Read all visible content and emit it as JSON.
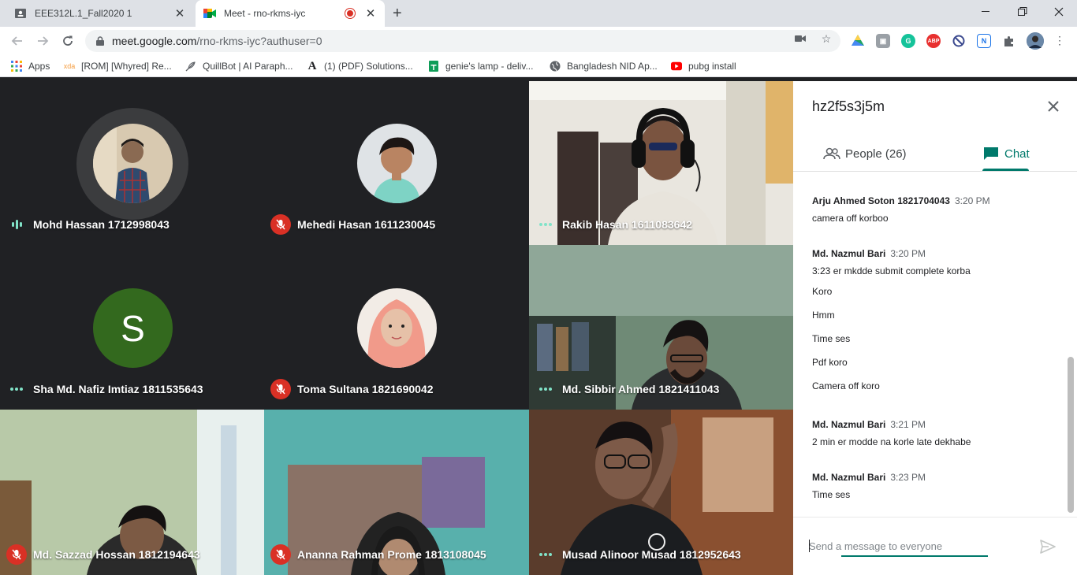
{
  "browser": {
    "tabs": [
      {
        "title": "EEE312L.1_Fall2020 1",
        "favicon": "classroom-icon"
      },
      {
        "title": "Meet - rno-rkms-iyc",
        "favicon": "meet-icon",
        "recording": true
      }
    ],
    "url_host": "meet.google.com",
    "url_path": "/rno-rkms-iyc?authuser=0",
    "bookmarks": [
      {
        "label": "Apps",
        "icon": "apps-grid-icon"
      },
      {
        "label": "[ROM] [Whyred] Re...",
        "icon": "xda-icon"
      },
      {
        "label": "QuillBot | AI Paraph...",
        "icon": "feather-icon"
      },
      {
        "label": "(1) (PDF) Solutions...",
        "icon": "font-a-icon"
      },
      {
        "label": "genie's lamp - deliv...",
        "icon": "sheet-icon"
      },
      {
        "label": "Bangladesh NID Ap...",
        "icon": "globe-icon"
      },
      {
        "label": "pubg install",
        "icon": "youtube-icon"
      }
    ],
    "extensions": [
      "drive-ext-icon",
      "photo-ext-icon",
      "grammarly-icon",
      "adblock-icon",
      "block-icon",
      "onenote-icon",
      "puzzle-icon",
      "profile-avatar"
    ]
  },
  "meet": {
    "tiles": [
      {
        "name": "Mohd Hassan 1712998043",
        "status": "speaking",
        "type": "avatar"
      },
      {
        "name": "Mehedi Hasan 1611230045",
        "status": "muted",
        "type": "avatar"
      },
      {
        "name": "Rakib Hasan 1611083642",
        "status": "dots",
        "type": "video"
      },
      {
        "name": "Sha Md. Nafiz Imtiaz 1811535643",
        "status": "dots",
        "type": "letter",
        "letter": "S"
      },
      {
        "name": "Toma Sultana 1821690042",
        "status": "muted",
        "type": "avatar"
      },
      {
        "name": "Md. Sibbir Ahmed 1821411043",
        "status": "dots",
        "type": "video"
      },
      {
        "name": "Md. Sazzad Hossan 1812194643",
        "status": "muted",
        "type": "video"
      },
      {
        "name": "Ananna Rahman Prome 1813108045",
        "status": "muted",
        "type": "video"
      },
      {
        "name": "Musad Alinoor Musad 1812952643",
        "status": "dots",
        "type": "video"
      }
    ]
  },
  "panel": {
    "title": "hz2f5s3j5m",
    "people_tab": "People (26)",
    "chat_tab": "Chat",
    "messages": [
      {
        "sender": "Arju Ahmed Soton 1821704043",
        "time": "3:20 PM",
        "lines": [
          "camera off korboo"
        ]
      },
      {
        "sender": "Md. Nazmul Bari",
        "time": "3:20 PM",
        "lines": [
          "3:23 er mkdde submit complete korba",
          "Koro",
          "Hmm",
          "Time ses",
          "Pdf koro",
          "Camera off koro"
        ]
      },
      {
        "sender": "Md. Nazmul Bari",
        "time": "3:21 PM",
        "lines": [
          "2 min er modde na korle late dekhabe"
        ]
      },
      {
        "sender": "Md. Nazmul Bari",
        "time": "3:23 PM",
        "lines": [
          "Time ses"
        ]
      }
    ],
    "compose_placeholder": "Send a message to everyone"
  },
  "colors": {
    "accent": "#00796b",
    "meet_bg": "#202124",
    "muted_red": "#d93025",
    "letter_avatar": "#33691e"
  }
}
